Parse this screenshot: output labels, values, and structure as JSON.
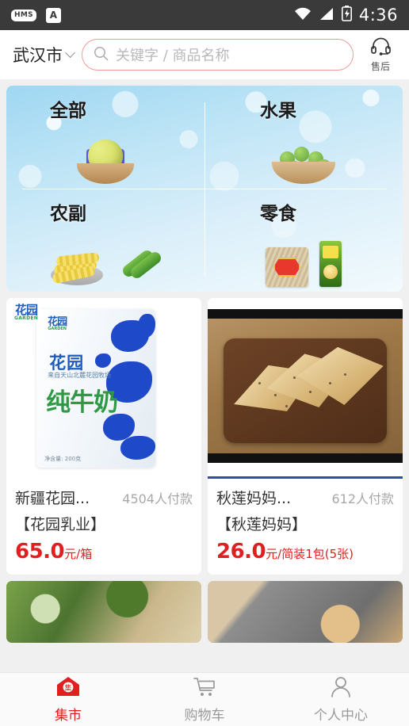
{
  "status_bar": {
    "hms_badge": "HMS",
    "input_badge": "A",
    "time": "4:36",
    "icons": [
      "wifi-icon",
      "signal-icon",
      "battery-charging-icon"
    ]
  },
  "header": {
    "city": "武汉市",
    "chevron": "chevron-down-icon",
    "search": {
      "icon": "search-icon",
      "placeholder": "关键字 / 商品名称",
      "value": ""
    },
    "service": {
      "icon": "headset-icon",
      "label": "售后"
    }
  },
  "category_banner": {
    "categories": [
      {
        "label": "全部",
        "art": "grapes-in-basket"
      },
      {
        "label": "水果",
        "art": "green-apples-in-basket"
      },
      {
        "label": "农副",
        "art": "corn-and-cucumber"
      },
      {
        "label": "零食",
        "art": "snack-bags"
      }
    ]
  },
  "products": [
    {
      "brand_badge_cn": "花园",
      "brand_badge_en": "GARDEN",
      "image": "milk-pack-photo",
      "image_text": {
        "logo_cn": "花园",
        "logo_en": "GARDEN",
        "line1": "花园",
        "line2": "来自天山北麓花园牧场",
        "line3": "纯牛奶",
        "net_weight": "净含量: 200克"
      },
      "name": "新疆花园...",
      "paid_count": "4504人付款",
      "subtitle": "【花园乳业】",
      "price_amount": "65.0",
      "price_unit": "元/箱"
    },
    {
      "image": "flatbread-on-wooden-board-photo",
      "name": "秋莲妈妈...",
      "paid_count": "612人付款",
      "subtitle": "【秋莲妈妈】",
      "price_amount": "26.0",
      "price_unit": "元/简装1包(5张)"
    }
  ],
  "partial_products": [
    {
      "image": "herbs-and-pastry-photo"
    },
    {
      "image": "rolled-pastry-photo"
    }
  ],
  "tabbar": {
    "items": [
      {
        "label": "集市",
        "icon": "market-house-icon",
        "active": true
      },
      {
        "label": "购物车",
        "icon": "shopping-cart-icon",
        "active": false
      },
      {
        "label": "个人中心",
        "icon": "person-icon",
        "active": false
      }
    ]
  },
  "colors": {
    "accent_red": "#e02020",
    "status_bar_bg": "#3a3a3a",
    "page_bg": "#f0f0f0",
    "search_border": "#f19a9a",
    "muted_text": "#a8a8a8"
  }
}
